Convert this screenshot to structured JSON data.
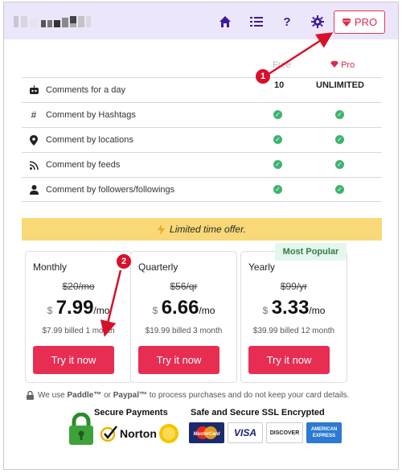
{
  "header": {
    "nav": [
      {
        "name": "home-icon",
        "glyph": "⌂"
      },
      {
        "name": "list-icon",
        "glyph": "☰"
      },
      {
        "name": "help-icon",
        "glyph": "?"
      },
      {
        "name": "gear-icon",
        "glyph": "⚙"
      }
    ],
    "pro_label": "PRO"
  },
  "comparison": {
    "free_label": "Free",
    "pro_label": "Pro",
    "free_value": "10",
    "pro_value": "UNLIMITED",
    "features": [
      {
        "icon": "robot-icon",
        "label": "Comments for a day",
        "free": false,
        "pro": false
      },
      {
        "icon": "hashtag-icon",
        "label": "Comment by Hashtags",
        "free": true,
        "pro": true
      },
      {
        "icon": "location-pin-icon",
        "label": "Comment by locations",
        "free": true,
        "pro": true
      },
      {
        "icon": "rss-feed-icon",
        "label": "Comment by feeds",
        "free": true,
        "pro": true
      },
      {
        "icon": "user-icon",
        "label": "Comment by followers/followings",
        "free": true,
        "pro": true
      }
    ]
  },
  "offer": {
    "text": "Limited time offer."
  },
  "plans": [
    {
      "name": "Monthly",
      "old_price": "$20/mo",
      "currency": "$",
      "price": "7.99",
      "period": "/mo",
      "billing": "$7.99 billed 1 month",
      "button": "Try it now"
    },
    {
      "name": "Quarterly",
      "old_price": "$56/qr",
      "currency": "$",
      "price": "6.66",
      "period": "/mo",
      "billing": "$19.99 billed 3 month",
      "button": "Try it now"
    },
    {
      "name": "Yearly",
      "old_price": "$99/yr",
      "currency": "$",
      "price": "3.33",
      "period": "/mo",
      "billing": "$39.99 billed 12 month",
      "button": "Try it now"
    }
  ],
  "popular_badge": "Most Popular",
  "payment_note": {
    "prefix": "We use ",
    "paddle": "Paddle™",
    "or": " or ",
    "paypal": "Paypal™",
    "suffix": " to process purchases and do not keep your card details."
  },
  "trust": {
    "secure_payments": "Secure Payments",
    "ssl": "Safe and Secure SSL Encrypted",
    "norton": "Norton",
    "cards": [
      "MasterCard",
      "VISA",
      "DISCOVER",
      "AMERICAN EXPRESS"
    ]
  },
  "annotations": [
    "1",
    "2"
  ],
  "colors": {
    "header_bg": "#ece6fb",
    "nav_icon": "#3f1b9b",
    "accent_red": "#e82d53",
    "check_green": "#3cb46e",
    "offer_bg": "#f8d877",
    "popular_bg": "#e4f7ed"
  }
}
